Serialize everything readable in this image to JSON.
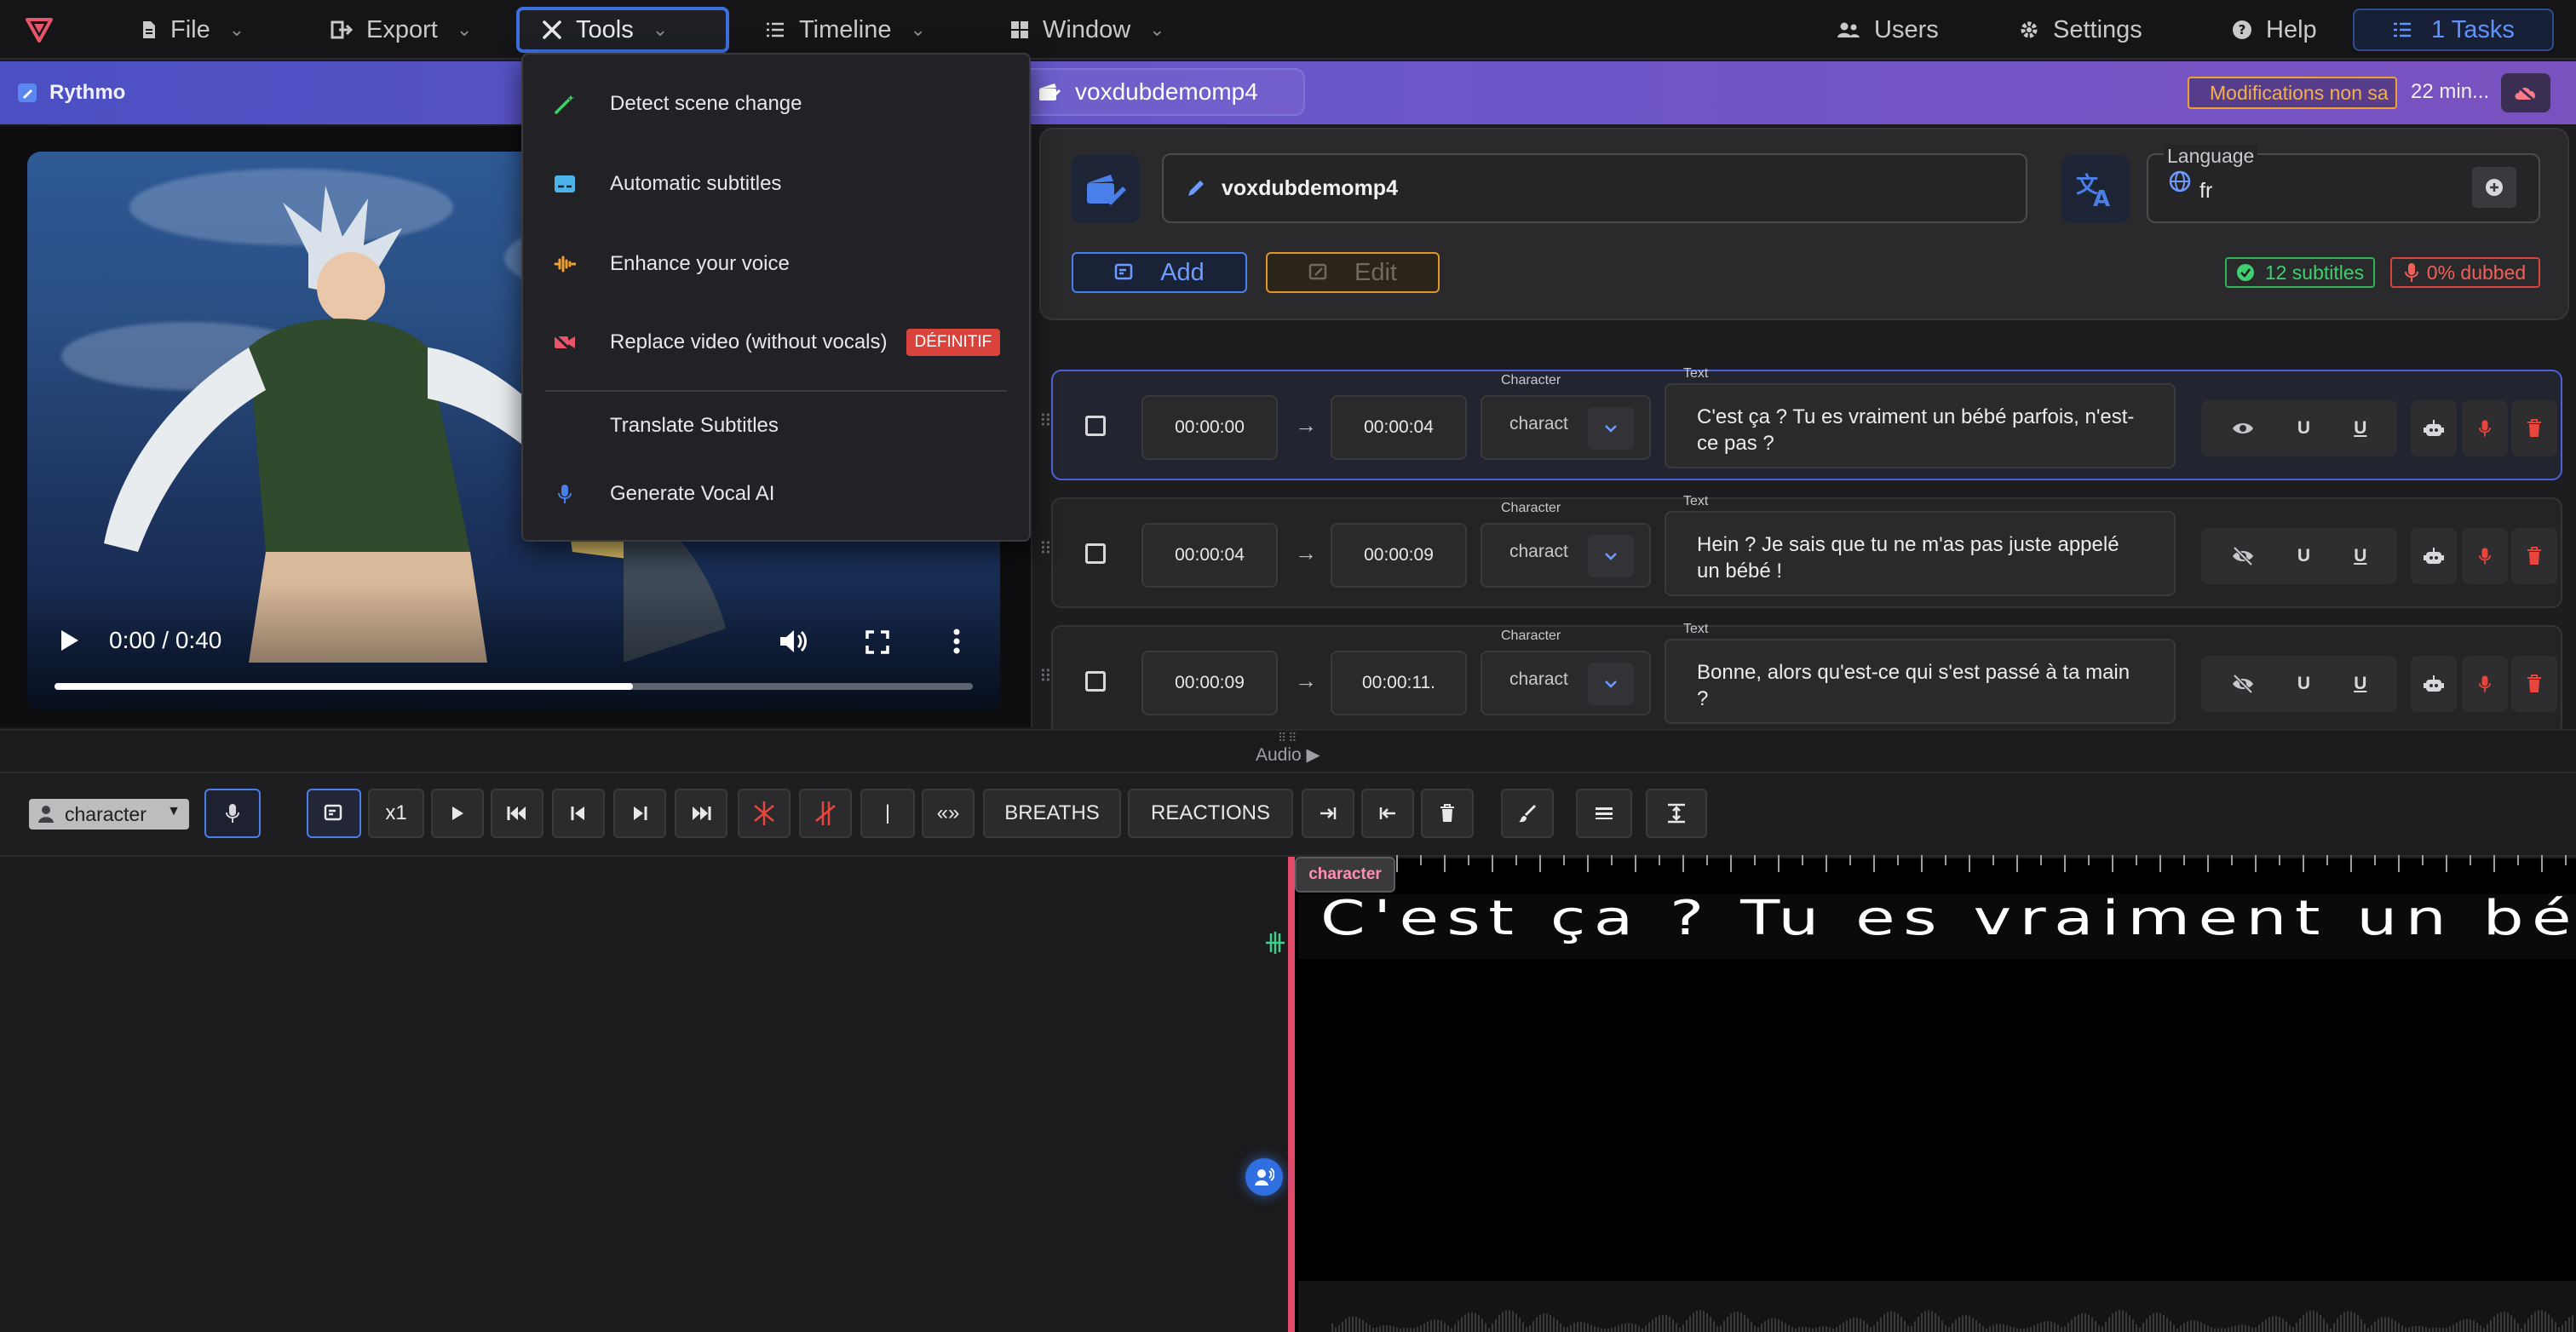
{
  "menubar": {
    "file": "File",
    "export": "Export",
    "tools": "Tools",
    "timeline": "Timeline",
    "window": "Window",
    "users": "Users",
    "settings": "Settings",
    "help": "Help",
    "tasks": "1 Tasks"
  },
  "project": {
    "app_name": "Rythmo",
    "file_name": "voxdubdemomp4",
    "unsaved": "Modifications non sa",
    "time_ago": "22 min..."
  },
  "video": {
    "time": "0:00 / 0:40",
    "progress": 0.63
  },
  "tools_menu": {
    "items": [
      {
        "label": "Detect scene change"
      },
      {
        "label": "Automatic subtitles"
      },
      {
        "label": "Enhance your voice"
      },
      {
        "label": "Replace video (without vocals)",
        "badge": "DÉFINITIF"
      },
      {
        "label": "Translate Subtitles"
      },
      {
        "label": "Generate Vocal AI"
      }
    ]
  },
  "editor": {
    "title_value": "voxdubdemomp4",
    "language_label": "Language",
    "language_value": "fr",
    "add_label": "Add",
    "edit_label": "Edit",
    "subtitles_count": "12 subtitles",
    "dubbed_pct": "0% dubbed",
    "character_label": "Character",
    "text_label": "Text",
    "rows": [
      {
        "start": "00:00:00",
        "end": "00:00:04",
        "character": "charact",
        "text": "C'est ça ? Tu es vraiment un bébé parfois, n'est-ce pas ?",
        "u1": "U",
        "u2": "U"
      },
      {
        "start": "00:00:04",
        "end": "00:00:09",
        "character": "charact",
        "text": "Hein ? Je sais que tu ne m'as pas juste appelé un bébé !",
        "u1": "U",
        "u2": "U"
      },
      {
        "start": "00:00:09",
        "end": "00:00:11.",
        "character": "charact",
        "text": "Bonne, alors qu'est-ce qui s'est passé à ta main ?",
        "u1": "U",
        "u2": "U"
      }
    ]
  },
  "audio": {
    "label": "Audio ▶",
    "character_select": "character",
    "speed": "x1",
    "pipe": "|",
    "quotes": "«»",
    "breaths": "BREATHS",
    "reactions": "REACTIONS"
  },
  "timeline": {
    "character_tag": "character",
    "rythmo_text": "C'est ça ? Tu es vraiment un bébé parfois, n'est-ce pas ?"
  },
  "colors": {
    "accent_blue": "#3d6fe0",
    "playhead": "#e24a6a",
    "edit_orange": "#e0962a",
    "green": "#2fb45a",
    "red": "#d8453d"
  }
}
